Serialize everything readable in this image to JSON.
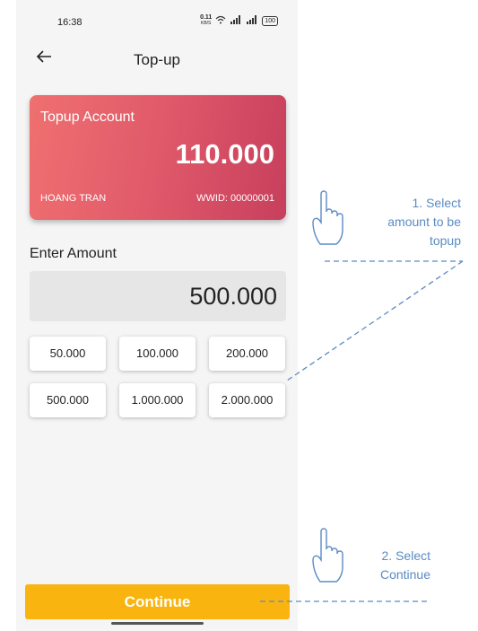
{
  "status_bar": {
    "time": "16:38",
    "speed": "0.11",
    "speed_unit": "KB/S",
    "battery": "100"
  },
  "header": {
    "title": "Top-up",
    "back_icon": "arrow-left-icon"
  },
  "card": {
    "title": "Topup Account",
    "balance": "110.000",
    "holder": "HOANG TRAN",
    "wwid": "WWID: 00000001",
    "gradient_colors": [
      "#ef7070",
      "#c73f5c"
    ]
  },
  "amount": {
    "label": "Enter Amount",
    "value": "500.000"
  },
  "presets": [
    "50.000",
    "100.000",
    "200.000",
    "500.000",
    "1.000.000",
    "2.000.000"
  ],
  "continue_label": "Continue",
  "annotations": {
    "note1": [
      "1. Select",
      "amount to be",
      "topup"
    ],
    "note2": [
      "2. Select",
      "Continue"
    ],
    "color": "#5b8bc4"
  },
  "accent_color": "#f9b410"
}
